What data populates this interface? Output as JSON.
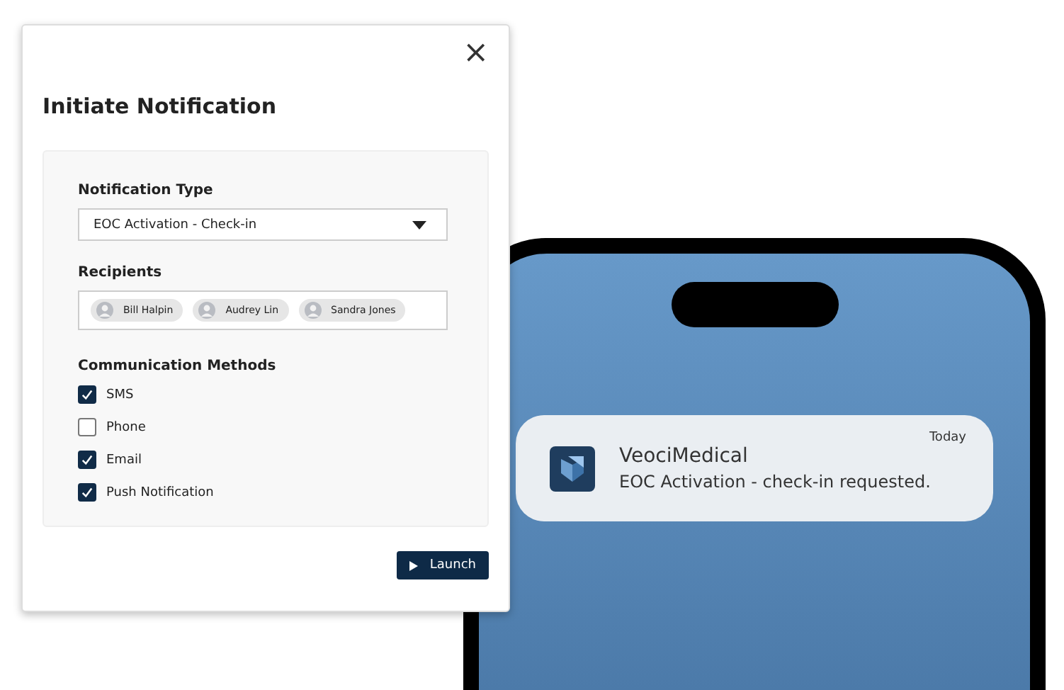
{
  "dialog": {
    "close": "×",
    "title": "Initiate Notification",
    "notification_type": {
      "label": "Notification Type",
      "value": "EOC Activation - Check-in"
    },
    "recipients": {
      "label": "Recipients",
      "people": [
        {
          "name": "Bill Halpin"
        },
        {
          "name": "Audrey Lin"
        },
        {
          "name": "Sandra Jones"
        }
      ]
    },
    "methods": {
      "label": "Communication Methods",
      "items": [
        {
          "label": "SMS",
          "checked": true
        },
        {
          "label": "Phone",
          "checked": false
        },
        {
          "label": "Email",
          "checked": true
        },
        {
          "label": "Push Notification",
          "checked": true
        }
      ]
    },
    "launch": "Launch"
  },
  "phone": {
    "notification": {
      "app": "VeociMedical",
      "message": "EOC Activation - check-in requested.",
      "time": "Today"
    }
  }
}
